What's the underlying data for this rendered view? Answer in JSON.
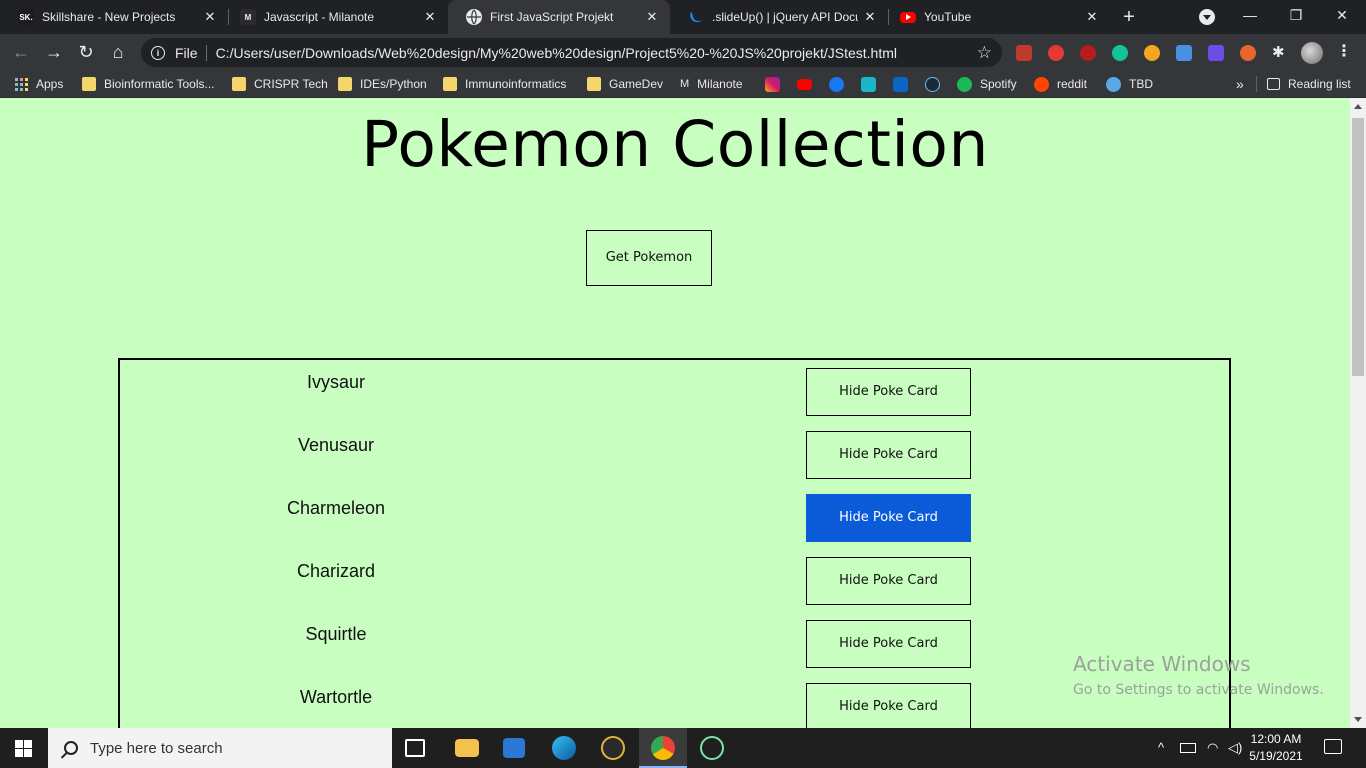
{
  "browser": {
    "tabs": [
      {
        "title": "Skillshare - New Projects",
        "favicon": "skillshare-icon",
        "fav_text": "SK.",
        "color": "#1d1d1f",
        "active": false
      },
      {
        "title": "Javascript - Milanote",
        "favicon": "milanote-icon",
        "fav_text": "M",
        "color": "#2b2b2b",
        "active": false
      },
      {
        "title": "First JavaScript Projekt",
        "favicon": "globe-icon",
        "fav_text": "",
        "color": "#e8eaed",
        "active": true
      },
      {
        "title": ".slideUp() | jQuery API Docum",
        "favicon": "jquery-icon",
        "fav_text": "",
        "color": "#0769ad",
        "active": false
      },
      {
        "title": "YouTube",
        "favicon": "youtube-icon",
        "fav_text": "",
        "color": "#ff0000",
        "active": false
      }
    ],
    "omnibox": {
      "scheme_label": "File",
      "url": "C:/Users/user/Downloads/Web%20design/My%20web%20design/Project5%20-%20JS%20projekt/JStest.html"
    },
    "bookmarks": [
      {
        "label": "Apps"
      },
      {
        "label": "Bioinformatic Tools..."
      },
      {
        "label": "CRISPR Tech"
      },
      {
        "label": "IDEs/Python"
      },
      {
        "label": "Immunoinformatics"
      },
      {
        "label": "GameDev"
      },
      {
        "label": "Milanote"
      },
      {
        "label": "Spotify"
      },
      {
        "label": "reddit"
      },
      {
        "label": "TBD"
      }
    ],
    "reading_list_label": "Reading list",
    "more_bookmarks_glyph": "»"
  },
  "page": {
    "heading": "Pokemon Collection",
    "get_button_label": "Get Pokemon",
    "pokemon": [
      {
        "name": "Ivysaur",
        "button_label": "Hide Poke Card",
        "active": false
      },
      {
        "name": "Venusaur",
        "button_label": "Hide Poke Card",
        "active": false
      },
      {
        "name": "Charmeleon",
        "button_label": "Hide Poke Card",
        "active": true
      },
      {
        "name": "Charizard",
        "button_label": "Hide Poke Card",
        "active": false
      },
      {
        "name": "Squirtle",
        "button_label": "Hide Poke Card",
        "active": false
      },
      {
        "name": "Wartortle",
        "button_label": "Hide Poke Card",
        "active": false
      }
    ],
    "background_color": "#c8ffc0",
    "active_button_color": "#0b5bd8"
  },
  "watermark": {
    "line1": "Activate Windows",
    "line2": "Go to Settings to activate Windows."
  },
  "taskbar": {
    "search_placeholder": "Type here to search",
    "time": "12:00 AM",
    "date": "5/19/2021"
  }
}
